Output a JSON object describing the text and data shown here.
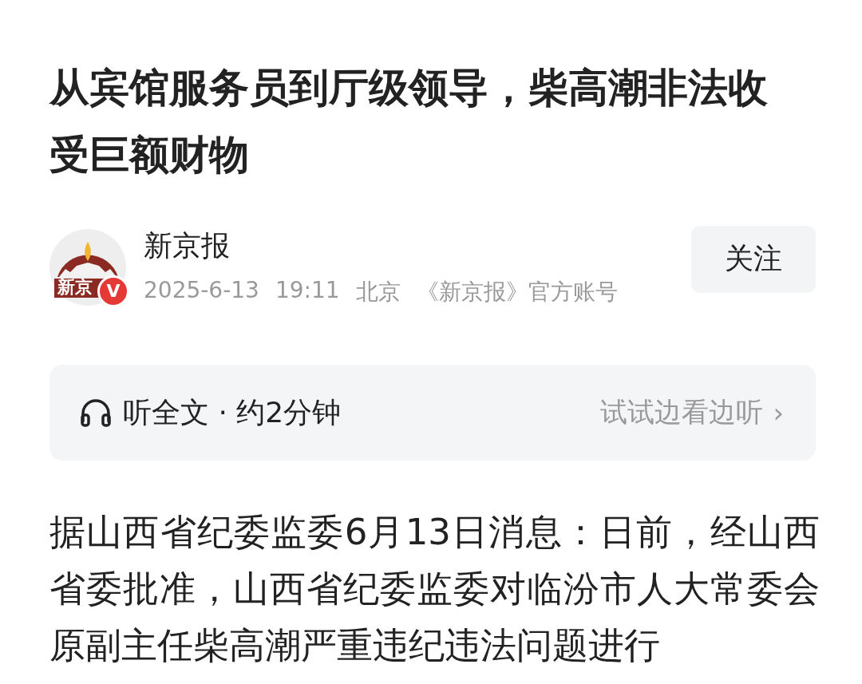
{
  "article": {
    "title": "从宾馆服务员到厅级领导，柴高潮非法收受巨额财物"
  },
  "author": {
    "logo_text": "新京",
    "verified_badge": "V",
    "name": "新京报",
    "date": "2025-6-13",
    "time": "19:11",
    "location": "北京",
    "account": "《新京报》官方账号",
    "follow_button": "关注"
  },
  "listen_card": {
    "label": "听全文 · 约2分钟",
    "link": "试试边看边听",
    "chevron": "›"
  },
  "body": {
    "paragraph": "据山西省纪委监委6月13日消息：日前，经山西省委批准，山西省纪委监委对临汾市人大常委会原副主任柴高潮严重违纪违法问题进行"
  }
}
